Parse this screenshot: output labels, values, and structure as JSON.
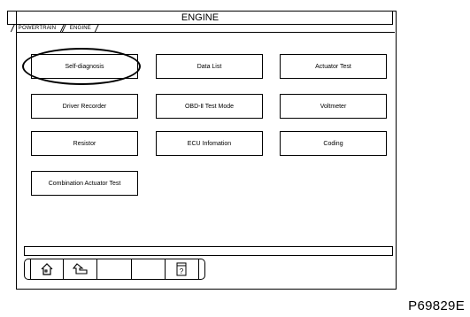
{
  "window": {
    "title": "ENGINE"
  },
  "breadcrumb": {
    "part1": "POWERTRAIN",
    "part2": "ENGINE"
  },
  "buttons": {
    "self_diagnosis": "Self-diagnosis",
    "data_list": "Data List",
    "actuator_test": "Actuator Test",
    "driver_recorder": "Driver Recorder",
    "obd_test_mode": "OBD-Ⅱ Test Mode",
    "voltmeter": "Voltmeter",
    "resistor": "Resistor",
    "ecu_information": "ECU Infomation",
    "coding": "Coding",
    "combination_actuator_test": "Combination Actuator Test"
  },
  "toolbar": {
    "icons": [
      "home-icon",
      "back-icon",
      "blank-icon",
      "blank-icon",
      "help-icon"
    ]
  },
  "figure_code": "P69829E"
}
